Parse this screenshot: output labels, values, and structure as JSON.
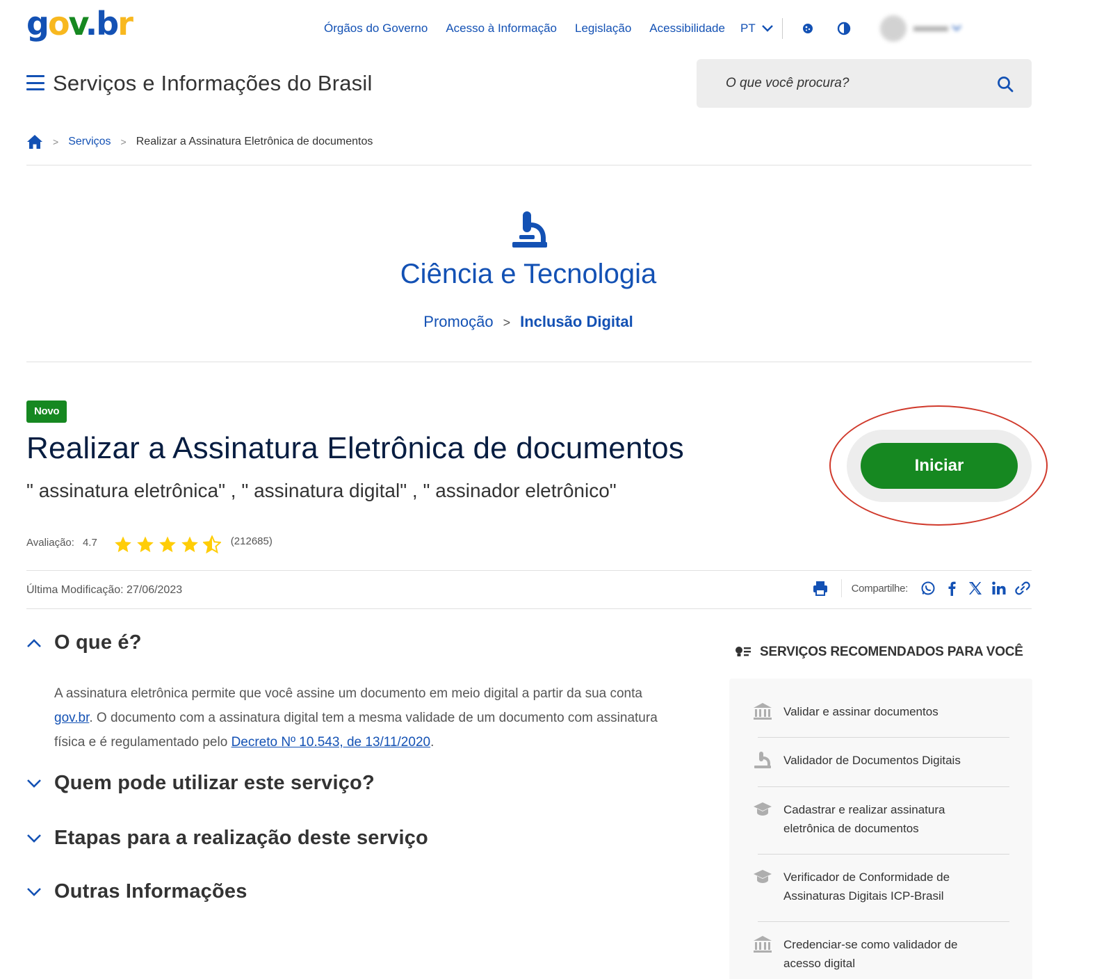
{
  "header": {
    "logo": {
      "g": "g",
      "o": "o",
      "v": "v",
      "dot": ".",
      "b": "b",
      "r": "r"
    },
    "links": [
      "Órgãos do Governo",
      "Acesso à Informação",
      "Legislação",
      "Acessibilidade"
    ],
    "language": "PT",
    "site_title": "Serviços e Informações do Brasil",
    "search_placeholder": "O que você procura?"
  },
  "breadcrumb": {
    "items": [
      "Serviços",
      "Realizar a Assinatura Eletrônica de documentos"
    ]
  },
  "category": {
    "title": "Ciência e Tecnologia",
    "crumb_parent": "Promoção",
    "crumb_child": "Inclusão Digital"
  },
  "service": {
    "badge": "Novo",
    "title": "Realizar a Assinatura Eletrônica de documentos",
    "keywords": "\" assinatura eletrônica\" , \" assinatura digital\" , \" assinador eletrônico\"",
    "rating_label": "Avaliação:",
    "rating_value": "4.7",
    "rating_count": "(212685)",
    "stars": 4.5,
    "cta_label": "Iniciar",
    "last_modified": "Última Modificação: 27/06/2023",
    "share_label": "Compartilhe:"
  },
  "accordion": [
    {
      "title": "O que é?",
      "expanded": true
    },
    {
      "title": "Quem pode utilizar este serviço?",
      "expanded": false
    },
    {
      "title": "Etapas para a realização deste serviço",
      "expanded": false
    },
    {
      "title": "Outras Informações",
      "expanded": false
    }
  ],
  "what_is": {
    "text1": "A assinatura eletrônica permite que você assine um documento em meio digital a partir da sua conta ",
    "link1": "gov.br",
    "text2": ". O documento com a assinatura digital tem a mesma validade de um documento com assinatura física e é regulamentado pelo ",
    "link2": "Decreto Nº 10.543, de 13/11/2020",
    "text3": "."
  },
  "recommended": {
    "heading": "SERVIÇOS RECOMENDADOS PARA VOCÊ",
    "items": [
      {
        "label": "Validar e assinar documentos",
        "icon": "bank-icon"
      },
      {
        "label": "Validador de Documentos Digitais",
        "icon": "microscope-icon"
      },
      {
        "label": "Cadastrar e realizar assinatura eletrônica de documentos",
        "icon": "graduation-cap-icon"
      },
      {
        "label": "Verificador de Conformidade de Assinaturas Digitais ICP-Brasil",
        "icon": "graduation-cap-icon"
      },
      {
        "label": "Credenciar-se como validador de acesso digital",
        "icon": "bank-icon"
      }
    ]
  },
  "colors": {
    "primary_blue": "#1351b4",
    "dark_blue": "#071d41",
    "green": "#168821",
    "star": "#ffcd07",
    "highlight": "#d0392b"
  }
}
